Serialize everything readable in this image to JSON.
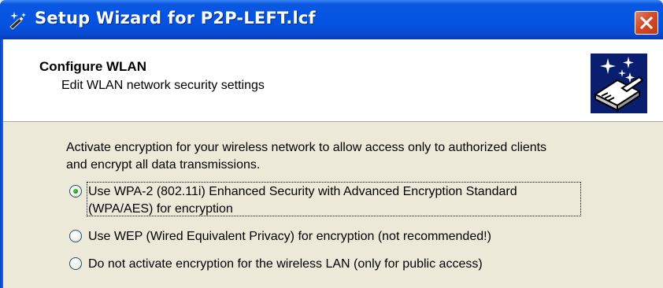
{
  "window": {
    "title": "Setup Wizard for P2P-LEFT.lcf",
    "title_icon": "wizard-wand-icon",
    "close_icon": "close-icon",
    "titlebar_color": "#0554e3",
    "close_color": "#d34a28"
  },
  "header": {
    "title": "Configure WLAN",
    "subtitle": "Edit WLAN network security settings",
    "graphic": "router-sparkle-icon"
  },
  "content": {
    "intro_line1": "Activate encryption for your wireless network to allow access only to authorized clients",
    "intro_line2": "and encrypt all data transmissions.",
    "options": [
      {
        "line1": "Use WPA-2 (802.11i) Enhanced Security with Advanced Encryption Standard",
        "line2": "(WPA/AES) for encryption",
        "selected": true
      },
      {
        "line1": "Use WEP (Wired Equivalent Privacy) for encryption (not recommended!)",
        "selected": false
      },
      {
        "line1": "Do not activate encryption for the wireless LAN (only for public access)",
        "selected": false
      }
    ]
  }
}
